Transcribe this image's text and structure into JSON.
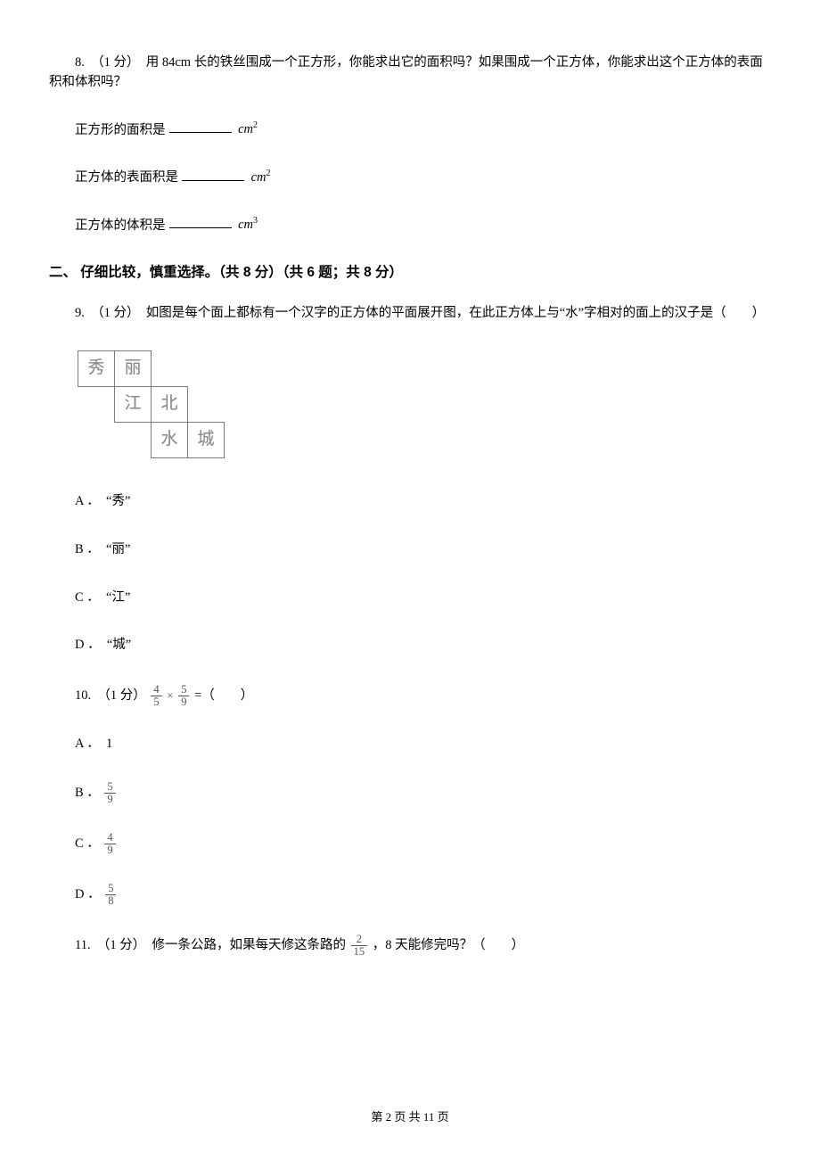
{
  "q8": {
    "stem": "8.　（1 分）　用 84cm 长的铁丝围成一个正方形，你能求出它的面积吗？如果围成一个正方体，你能求出这个正方体的表面积和体积吗？",
    "lines": {
      "l1_pre": "正方形的面积是",
      "l2_pre": "正方体的表面积是",
      "l3_pre": "正方体的体积是"
    }
  },
  "section2": "二、 仔细比较，慎重选择。（共 8 分）（共 6 题；共 8 分）",
  "q9": {
    "stem": "9.　（1 分）　如图是每个面上都标有一个汉字的正方体的平面展开图，在此正方体上与“水”字相对的面上的汉子是（　　）",
    "net": {
      "c1": "秀",
      "c2": "丽",
      "c3": "江",
      "c4": "北",
      "c5": "水",
      "c6": "城"
    },
    "opts": {
      "A": "A ．　“秀”",
      "B": "B ．　“丽”",
      "C": "C ．　“江”",
      "D": "D ．　“城”"
    }
  },
  "q10": {
    "stem_pre": "10.　（1 分）",
    "stem_post": " =（　　）",
    "expr": {
      "a_n": "4",
      "a_d": "5",
      "b_n": "5",
      "b_d": "9"
    },
    "opts": {
      "A": "A ．　1",
      "B_pre": "B ．",
      "B_frac": {
        "n": "5",
        "d": "9"
      },
      "C_pre": "C ．",
      "C_frac": {
        "n": "4",
        "d": "9"
      },
      "D_pre": "D ．",
      "D_frac": {
        "n": "5",
        "d": "8"
      }
    }
  },
  "q11": {
    "pre": "11.　（1 分）　修一条公路，如果每天修这条路的 ",
    "frac": {
      "n": "2",
      "d": "15"
    },
    "post": " ，8 天能修完吗？（　　）"
  },
  "footer": "第 2 页 共 11 页"
}
